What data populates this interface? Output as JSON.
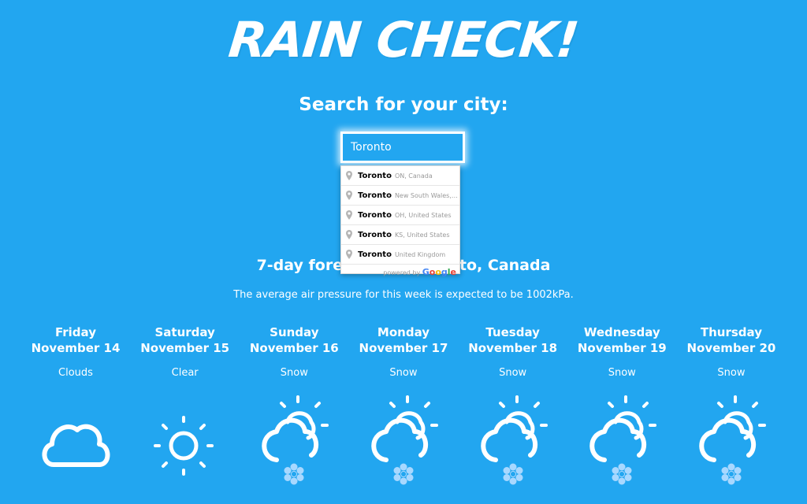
{
  "app": {
    "logo": "RAIN CHECK!"
  },
  "search": {
    "label": "Search for your city:",
    "value": "Toronto"
  },
  "autocomplete": {
    "items": [
      {
        "main": "Toronto",
        "sub": "ON, Canada"
      },
      {
        "main": "Toronto",
        "sub": "New South Wales, ..."
      },
      {
        "main": "Toronto",
        "sub": "OH, United States"
      },
      {
        "main": "Toronto",
        "sub": "KS, United States"
      },
      {
        "main": "Toronto",
        "sub": "United Kingdom"
      }
    ],
    "powered_by": "powered by",
    "google": [
      "G",
      "o",
      "o",
      "g",
      "l",
      "e"
    ]
  },
  "forecast": {
    "title": "7-day forecast for Toronto, Canada",
    "pressure_text": "The average air pressure for this week is expected to be 1002kPa.",
    "days": [
      {
        "name": "Friday",
        "date": "November 14",
        "condition": "Clouds",
        "icon": "cloud-icon"
      },
      {
        "name": "Saturday",
        "date": "November 15",
        "condition": "Clear",
        "icon": "sun-icon"
      },
      {
        "name": "Sunday",
        "date": "November 16",
        "condition": "Snow",
        "icon": "snow-icon"
      },
      {
        "name": "Monday",
        "date": "November 17",
        "condition": "Snow",
        "icon": "snow-icon"
      },
      {
        "name": "Tuesday",
        "date": "November 18",
        "condition": "Snow",
        "icon": "snow-icon"
      },
      {
        "name": "Wednesday",
        "date": "November 19",
        "condition": "Snow",
        "icon": "snow-icon"
      },
      {
        "name": "Thursday",
        "date": "November 20",
        "condition": "Snow",
        "icon": "snow-icon"
      }
    ]
  },
  "colors": {
    "background": "#22a6f0",
    "text": "#ffffff",
    "snowflake": "#a8d8ff"
  }
}
